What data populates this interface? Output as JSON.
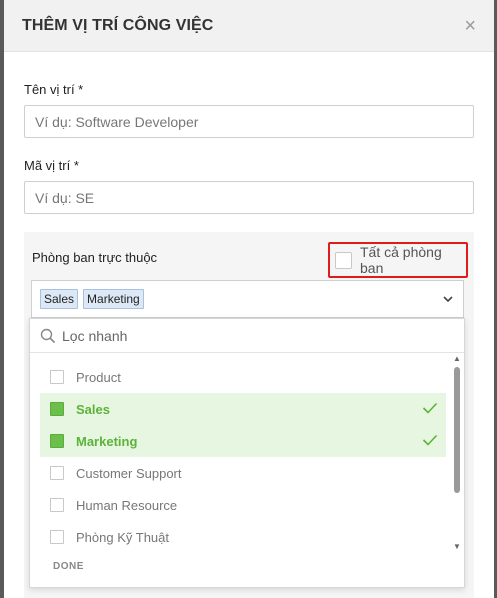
{
  "modal": {
    "title": "THÊM VỊ TRÍ CÔNG VIỆC",
    "close_icon": "close-icon"
  },
  "fields": {
    "position_name": {
      "label": "Tên vị trí *",
      "placeholder": "Ví dụ: Software Developer",
      "value": ""
    },
    "position_code": {
      "label": "Mã vị trí *",
      "placeholder": "Ví dụ: SE",
      "value": ""
    }
  },
  "department": {
    "label": "Phòng ban trực thuộc",
    "all_departments_label": "Tất cả phòng ban",
    "all_departments_checked": false,
    "selected_tags": [
      "Sales",
      "Marketing"
    ],
    "chevron_icon": "chevron-down-icon"
  },
  "dropdown": {
    "search_placeholder": "Lọc nhanh",
    "options": [
      {
        "label": "Product",
        "selected": false
      },
      {
        "label": "Sales",
        "selected": true
      },
      {
        "label": "Marketing",
        "selected": true
      },
      {
        "label": "Customer Support",
        "selected": false
      },
      {
        "label": "Human Resource",
        "selected": false
      },
      {
        "label": "Phòng Kỹ Thuật",
        "selected": false
      }
    ],
    "done_label": "DONE"
  },
  "colors": {
    "highlight_border": "#e01b1b",
    "selected_green": "#5db33a",
    "selected_bg": "#e7f6e1",
    "tag_bg": "#dde8f6"
  }
}
